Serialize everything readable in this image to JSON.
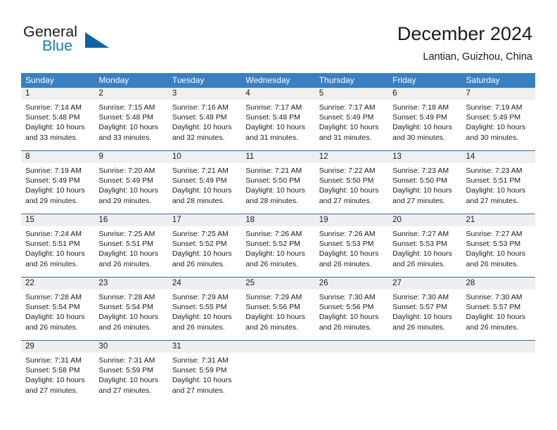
{
  "brand": {
    "word1": "General",
    "word2": "Blue",
    "logo_icon": "triangle-logo-icon"
  },
  "header": {
    "title": "December 2024",
    "subtitle": "Lantian, Guizhou, China"
  },
  "calendar": {
    "weekdays": [
      "Sunday",
      "Monday",
      "Tuesday",
      "Wednesday",
      "Thursday",
      "Friday",
      "Saturday"
    ],
    "header_bg": "#3a7fc1",
    "separator_color": "#2d6ca8",
    "day_band_bg": "#efefef",
    "weeks": [
      [
        {
          "day": "1",
          "lines": [
            "Sunrise: 7:14 AM",
            "Sunset: 5:48 PM",
            "Daylight: 10 hours",
            "and 33 minutes."
          ]
        },
        {
          "day": "2",
          "lines": [
            "Sunrise: 7:15 AM",
            "Sunset: 5:48 PM",
            "Daylight: 10 hours",
            "and 33 minutes."
          ]
        },
        {
          "day": "3",
          "lines": [
            "Sunrise: 7:16 AM",
            "Sunset: 5:48 PM",
            "Daylight: 10 hours",
            "and 32 minutes."
          ]
        },
        {
          "day": "4",
          "lines": [
            "Sunrise: 7:17 AM",
            "Sunset: 5:48 PM",
            "Daylight: 10 hours",
            "and 31 minutes."
          ]
        },
        {
          "day": "5",
          "lines": [
            "Sunrise: 7:17 AM",
            "Sunset: 5:49 PM",
            "Daylight: 10 hours",
            "and 31 minutes."
          ]
        },
        {
          "day": "6",
          "lines": [
            "Sunrise: 7:18 AM",
            "Sunset: 5:49 PM",
            "Daylight: 10 hours",
            "and 30 minutes."
          ]
        },
        {
          "day": "7",
          "lines": [
            "Sunrise: 7:19 AM",
            "Sunset: 5:49 PM",
            "Daylight: 10 hours",
            "and 30 minutes."
          ]
        }
      ],
      [
        {
          "day": "8",
          "lines": [
            "Sunrise: 7:19 AM",
            "Sunset: 5:49 PM",
            "Daylight: 10 hours",
            "and 29 minutes."
          ]
        },
        {
          "day": "9",
          "lines": [
            "Sunrise: 7:20 AM",
            "Sunset: 5:49 PM",
            "Daylight: 10 hours",
            "and 29 minutes."
          ]
        },
        {
          "day": "10",
          "lines": [
            "Sunrise: 7:21 AM",
            "Sunset: 5:49 PM",
            "Daylight: 10 hours",
            "and 28 minutes."
          ]
        },
        {
          "day": "11",
          "lines": [
            "Sunrise: 7:21 AM",
            "Sunset: 5:50 PM",
            "Daylight: 10 hours",
            "and 28 minutes."
          ]
        },
        {
          "day": "12",
          "lines": [
            "Sunrise: 7:22 AM",
            "Sunset: 5:50 PM",
            "Daylight: 10 hours",
            "and 27 minutes."
          ]
        },
        {
          "day": "13",
          "lines": [
            "Sunrise: 7:23 AM",
            "Sunset: 5:50 PM",
            "Daylight: 10 hours",
            "and 27 minutes."
          ]
        },
        {
          "day": "14",
          "lines": [
            "Sunrise: 7:23 AM",
            "Sunset: 5:51 PM",
            "Daylight: 10 hours",
            "and 27 minutes."
          ]
        }
      ],
      [
        {
          "day": "15",
          "lines": [
            "Sunrise: 7:24 AM",
            "Sunset: 5:51 PM",
            "Daylight: 10 hours",
            "and 26 minutes."
          ]
        },
        {
          "day": "16",
          "lines": [
            "Sunrise: 7:25 AM",
            "Sunset: 5:51 PM",
            "Daylight: 10 hours",
            "and 26 minutes."
          ]
        },
        {
          "day": "17",
          "lines": [
            "Sunrise: 7:25 AM",
            "Sunset: 5:52 PM",
            "Daylight: 10 hours",
            "and 26 minutes."
          ]
        },
        {
          "day": "18",
          "lines": [
            "Sunrise: 7:26 AM",
            "Sunset: 5:52 PM",
            "Daylight: 10 hours",
            "and 26 minutes."
          ]
        },
        {
          "day": "19",
          "lines": [
            "Sunrise: 7:26 AM",
            "Sunset: 5:53 PM",
            "Daylight: 10 hours",
            "and 26 minutes."
          ]
        },
        {
          "day": "20",
          "lines": [
            "Sunrise: 7:27 AM",
            "Sunset: 5:53 PM",
            "Daylight: 10 hours",
            "and 26 minutes."
          ]
        },
        {
          "day": "21",
          "lines": [
            "Sunrise: 7:27 AM",
            "Sunset: 5:53 PM",
            "Daylight: 10 hours",
            "and 26 minutes."
          ]
        }
      ],
      [
        {
          "day": "22",
          "lines": [
            "Sunrise: 7:28 AM",
            "Sunset: 5:54 PM",
            "Daylight: 10 hours",
            "and 26 minutes."
          ]
        },
        {
          "day": "23",
          "lines": [
            "Sunrise: 7:28 AM",
            "Sunset: 5:54 PM",
            "Daylight: 10 hours",
            "and 26 minutes."
          ]
        },
        {
          "day": "24",
          "lines": [
            "Sunrise: 7:29 AM",
            "Sunset: 5:55 PM",
            "Daylight: 10 hours",
            "and 26 minutes."
          ]
        },
        {
          "day": "25",
          "lines": [
            "Sunrise: 7:29 AM",
            "Sunset: 5:56 PM",
            "Daylight: 10 hours",
            "and 26 minutes."
          ]
        },
        {
          "day": "26",
          "lines": [
            "Sunrise: 7:30 AM",
            "Sunset: 5:56 PM",
            "Daylight: 10 hours",
            "and 26 minutes."
          ]
        },
        {
          "day": "27",
          "lines": [
            "Sunrise: 7:30 AM",
            "Sunset: 5:57 PM",
            "Daylight: 10 hours",
            "and 26 minutes."
          ]
        },
        {
          "day": "28",
          "lines": [
            "Sunrise: 7:30 AM",
            "Sunset: 5:57 PM",
            "Daylight: 10 hours",
            "and 26 minutes."
          ]
        }
      ],
      [
        {
          "day": "29",
          "lines": [
            "Sunrise: 7:31 AM",
            "Sunset: 5:58 PM",
            "Daylight: 10 hours",
            "and 27 minutes."
          ]
        },
        {
          "day": "30",
          "lines": [
            "Sunrise: 7:31 AM",
            "Sunset: 5:59 PM",
            "Daylight: 10 hours",
            "and 27 minutes."
          ]
        },
        {
          "day": "31",
          "lines": [
            "Sunrise: 7:31 AM",
            "Sunset: 5:59 PM",
            "Daylight: 10 hours",
            "and 27 minutes."
          ]
        },
        {
          "day": "",
          "lines": []
        },
        {
          "day": "",
          "lines": []
        },
        {
          "day": "",
          "lines": []
        },
        {
          "day": "",
          "lines": []
        }
      ]
    ]
  }
}
